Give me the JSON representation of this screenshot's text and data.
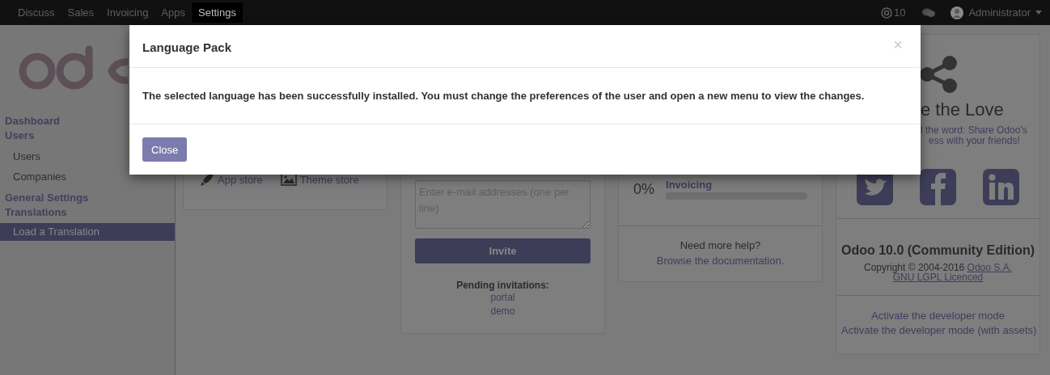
{
  "navbar": {
    "apps": [
      {
        "label": "Discuss",
        "selected": false
      },
      {
        "label": "Sales",
        "selected": false
      },
      {
        "label": "Invoicing",
        "selected": false
      },
      {
        "label": "Apps",
        "selected": false
      },
      {
        "label": "Settings",
        "selected": true
      }
    ],
    "mentions": "10",
    "user": "Administrator"
  },
  "sidebar": {
    "items": [
      {
        "label": "Dashboard",
        "kind": "heading",
        "selected": false
      },
      {
        "label": "Users",
        "kind": "heading",
        "selected": false
      },
      {
        "label": "Users",
        "kind": "item",
        "selected": false
      },
      {
        "label": "Companies",
        "kind": "item",
        "selected": false
      },
      {
        "label": "General Settings",
        "kind": "heading",
        "selected": false
      },
      {
        "label": "Translations",
        "kind": "heading",
        "selected": false
      },
      {
        "label": "Load a Translation",
        "kind": "item",
        "selected": true
      }
    ]
  },
  "apps_card": {
    "links": [
      "App store",
      "Theme store"
    ]
  },
  "invite_card": {
    "placeholder": "Enter e-mail addresses (one per line)",
    "button": "Invite",
    "pending_title": "Pending invitations:",
    "pending": [
      "portal",
      "demo"
    ]
  },
  "progress_card": {
    "percent": "0%",
    "step": "Invoicing",
    "level": 0,
    "help_text": "Need more help?",
    "help_link": "Browse the documentation."
  },
  "share_card": {
    "heading": "e the Love",
    "lines": [
      "l the word: Share Odoo's",
      "ess with your friends!"
    ],
    "version": "Odoo 10.0 (Community Edition)",
    "copyright": "Copyright © 2004-2016",
    "company_link": "Odoo S.A.",
    "license_link": "GNU LGPL Licenced",
    "developer_links": [
      "Activate the developer mode",
      "Activate the developer mode (with assets)"
    ]
  },
  "dialog": {
    "title": "Language Pack",
    "close_icon": "×",
    "message": "The selected language has been successfully installed. You must change the preferences of the user and open a new menu to view the changes.",
    "button": "Close"
  }
}
